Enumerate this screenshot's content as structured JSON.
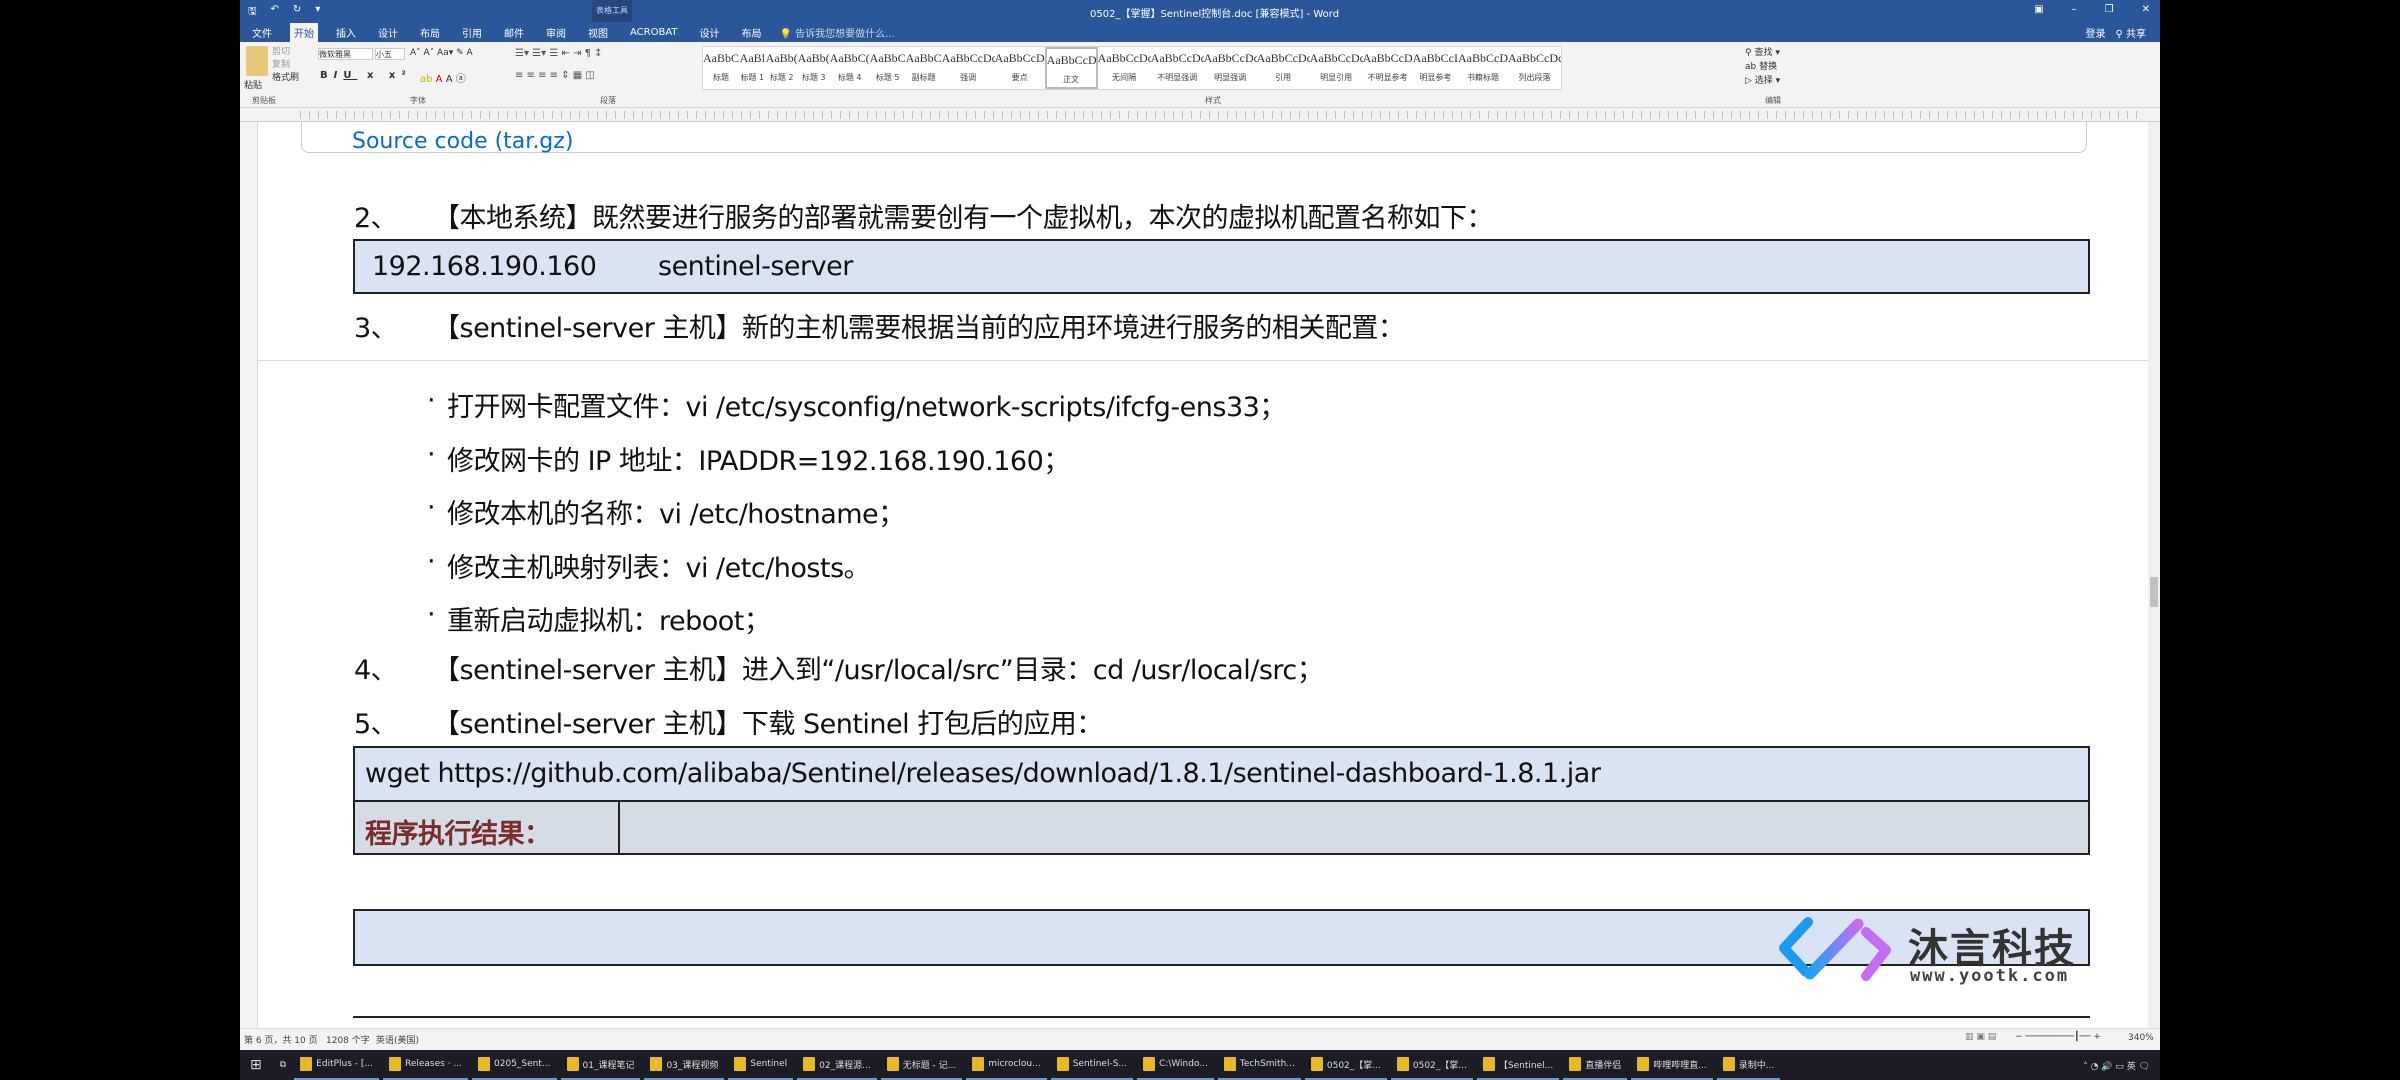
{
  "titlebar": {
    "title": "0502_【掌握】Sentinel控制台.doc [兼容模式] - Word",
    "context_tab": "表格工具",
    "window_controls": [
      "restore-ribbon",
      "minimize",
      "maximize",
      "close"
    ]
  },
  "tabs": [
    "文件",
    "开始",
    "插入",
    "设计",
    "布局",
    "引用",
    "邮件",
    "审阅",
    "视图",
    "ACROBAT",
    "设计",
    "布局"
  ],
  "active_tab": "开始",
  "tell_me": "告诉我您想要做什么...",
  "account": {
    "login": "登录",
    "share": "共享"
  },
  "ribbon": {
    "clipboard": {
      "paste": "粘贴",
      "cut": "剪切",
      "copy": "复制",
      "format_painter": "格式刷",
      "label": "剪贴板"
    },
    "font": {
      "name": "微软雅黑",
      "size": "小五",
      "label": "字体"
    },
    "paragraph": {
      "label": "段落"
    },
    "styles": {
      "label": "样式",
      "items": [
        {
          "sample": "AaBbC",
          "name": "标题"
        },
        {
          "sample": "AaBl",
          "name": "标题 1"
        },
        {
          "sample": "AaBb(",
          "name": "标题 2"
        },
        {
          "sample": "AaBb(",
          "name": "标题 3"
        },
        {
          "sample": "AaBbC(",
          "name": "标题 4"
        },
        {
          "sample": "AaBbC",
          "name": "标题 5"
        },
        {
          "sample": "AaBbC",
          "name": "副标题"
        },
        {
          "sample": "AaBbCcDc",
          "name": "强调"
        },
        {
          "sample": "AaBbCcD",
          "name": "要点"
        },
        {
          "sample": "AaBbCcDc",
          "name": "正文",
          "selected": true
        },
        {
          "sample": "AaBbCcDc",
          "name": "无间隔"
        },
        {
          "sample": "AaBbCcDc",
          "name": "不明显强调"
        },
        {
          "sample": "AaBbCcDc",
          "name": "明显强调"
        },
        {
          "sample": "AaBbCcDc",
          "name": "引用"
        },
        {
          "sample": "AaBbCcDc",
          "name": "明显引用"
        },
        {
          "sample": "AaBbCcD",
          "name": "不明显参考"
        },
        {
          "sample": "AaBbCcI",
          "name": "明显参考"
        },
        {
          "sample": "AaBbCcD",
          "name": "书籍标题"
        },
        {
          "sample": "AaBbCcDc",
          "name": "列出段落"
        }
      ]
    },
    "editing": {
      "find": "查找",
      "replace": "替换",
      "select": "选择",
      "label": "编辑"
    }
  },
  "doc": {
    "source_link": "Source code (tar.gz)",
    "step2": {
      "num": "2、",
      "text": "【本地系统】既然要进行服务的部署就需要创有一个虚拟机，本次的虚拟机配置名称如下："
    },
    "hosts_box": {
      "ip": "192.168.190.160",
      "name": "sentinel-server"
    },
    "step3": {
      "num": "3、",
      "text": "【sentinel-server 主机】新的主机需要根据当前的应用环境进行服务的相关配置："
    },
    "bullets": [
      "打开网卡配置文件：vi /etc/sysconfig/network-scripts/ifcfg-ens33；",
      "修改网卡的 IP 地址：IPADDR=192.168.190.160；",
      "修改本机的名称：vi /etc/hostname；",
      "修改主机映射列表：vi /etc/hosts。",
      "重新启动虚拟机：reboot；"
    ],
    "bullet_char": "·",
    "step4": {
      "num": "4、",
      "text": "【sentinel-server 主机】进入到“/usr/local/src”目录：cd /usr/local/src；"
    },
    "step5": {
      "num": "5、",
      "text": "【sentinel-server 主机】下载 Sentinel 打包后的应用："
    },
    "command": "wget https://github.com/alibaba/Sentinel/releases/download/1.8.1/sentinel-dashboard-1.8.1.jar",
    "result_label": "程序执行结果："
  },
  "watermark": {
    "name": "沐言科技",
    "url": "www.yootk.com"
  },
  "status": {
    "page": "第 6 页，共 10 页",
    "words": "1208 个字",
    "lang": "英语(美国)",
    "zoom": "340%"
  },
  "taskbar": [
    "EditPlus - [...",
    "Releases · ...",
    "0205_Sent...",
    "01_课程笔记",
    "03_课程视频",
    "Sentinel",
    "02_课程源...",
    "无标题 - 记...",
    "microclou...",
    "Sentinel-S...",
    "C:\\Windo...",
    "TechSmith...",
    "0502_【掌...",
    "0502_【掌...",
    "【Sentinel...",
    "直播伴侣",
    "哔哩哔哩直...",
    "录制中..."
  ],
  "colors": {
    "word_blue": "#2b579a",
    "box_fill": "#dae3f3",
    "result_label": "#7b2c2c",
    "link": "#0969da"
  }
}
